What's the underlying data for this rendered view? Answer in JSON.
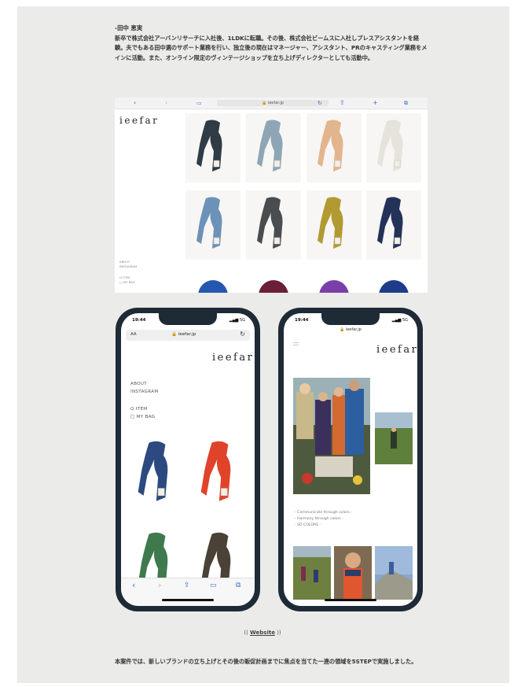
{
  "bio": {
    "name": "-田中 恵実",
    "text": "新卒で株式会社アーバンリサーチに入社後、1LDKに転職。その後、株式会社ビームスに入社しプレスアシスタントを経験。夫でもある田中選のサポート業務を行い、独立後の現在はマネージャー、アシスタント、PRのキャスティング業務をメインに活動。また、オンライン限定のヴィンテージショップを立ち上げディレクターとしても活動中。"
  },
  "desktop": {
    "url": "ieefar.jp",
    "logo": "ieefar",
    "nav": [
      "ABOUT",
      "INSTAGRAM",
      "",
      "Q ITEM",
      "□ MY BAG"
    ],
    "scarf_colors": [
      "#2f3b45",
      "#8ea5b6",
      "#e2b58e",
      "#e6e3dc",
      "#6d92b8",
      "#4a4d50",
      "#b29a33",
      "#24325a"
    ],
    "peek_colors": [
      "#2557b0",
      "#6b1f36",
      "#7b3fa8",
      "#1d3d8a"
    ]
  },
  "phone_left": {
    "time": "19:44",
    "signal": "5G",
    "tab_label": "AA",
    "url": "ieefar.jp",
    "logo": "ieefar",
    "nav": [
      "ABOUT",
      "INSTAGRAM",
      "",
      "Q ITEM",
      "□ MY BAG"
    ],
    "scarf_colors": [
      "#2c4a80",
      "#e0432a",
      "#3f7a4e",
      "#4a4237"
    ]
  },
  "phone_right": {
    "time": "19:44",
    "signal": "5G",
    "url": "ieefar.jp",
    "logo": "ieefar",
    "captions": [
      "- Communicate through colors -",
      "- Harmony through colors -",
      "- SO COLORS -"
    ]
  },
  "links": {
    "website_prefix": "((",
    "website": "Website",
    "website_suffix": "))"
  },
  "footer": {
    "text": "本案件では、新しいブランドの立ち上げとその後の販促計画までに焦点を当てた一連の領域を5STEPで実施しました。"
  }
}
